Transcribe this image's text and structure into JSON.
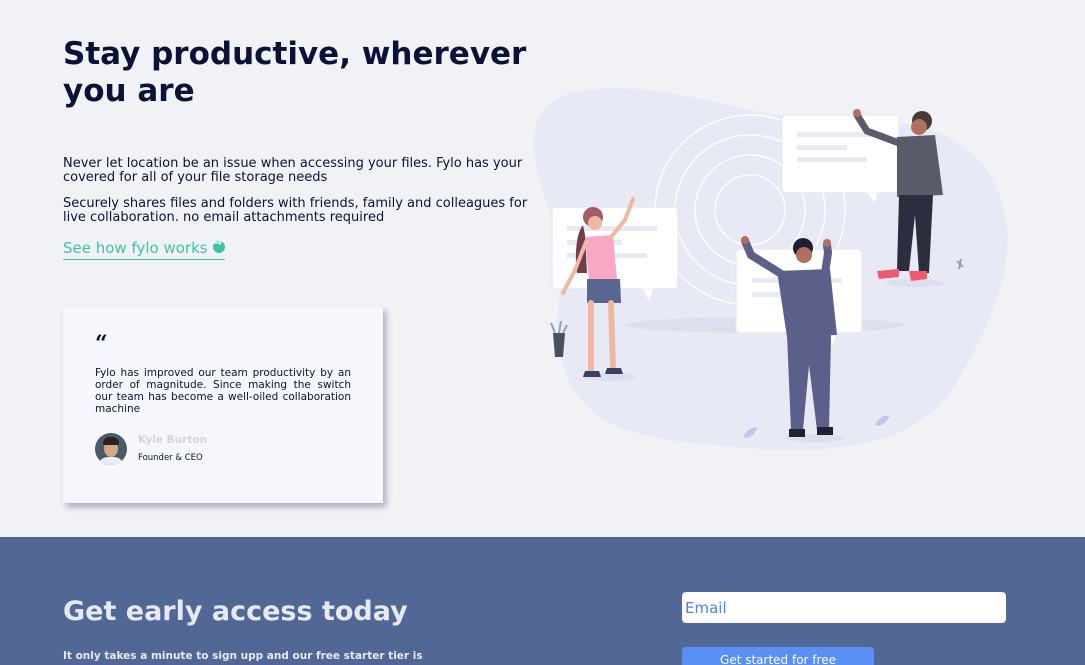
{
  "hero": {
    "headline": "Stay productive, wherever you are",
    "paragraph_1": "Never let location be an issue when accessing your files. Fylo has your covered for all of your file storage needs",
    "paragraph_2": "Securely shares files and folders with friends, family and colleagues for live collaboration. no email attachments required",
    "link_label": "See how fylo works",
    "link_icon": "arrow-right-circle-icon"
  },
  "testimonial": {
    "quote_icon": "quote-icon",
    "quote": "Fylo has improved our team productivity by an order of magnitude. Since making the switch our team has become a well-oiled collaboration machine",
    "author_name": "Kyle Burton",
    "author_role": "Founder & CEO"
  },
  "early_access": {
    "title": "Get early access today",
    "text": "It only takes a minute to sign upp and our free starter tier is",
    "email_placeholder": "Email",
    "button_label": "Get started for free"
  },
  "colors": {
    "navy": "#0c1137",
    "accent_green": "#3dc5a0",
    "blue_band": "#516796",
    "button_blue": "#5a8ff5",
    "background": "#f0f2f6"
  }
}
